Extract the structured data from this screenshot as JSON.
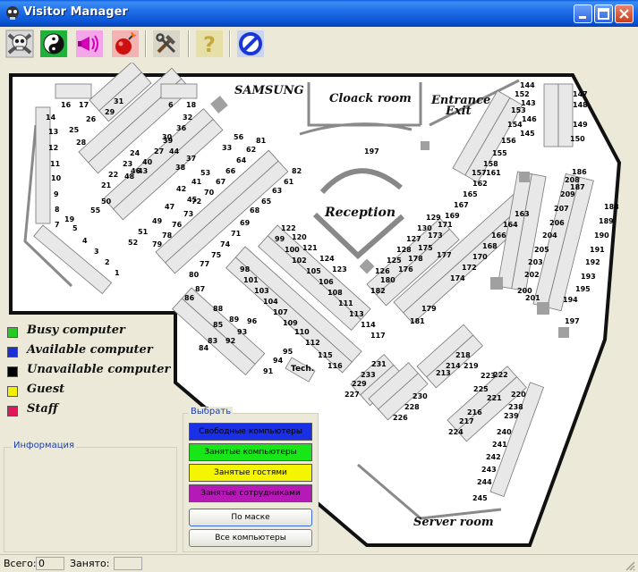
{
  "window": {
    "title": "Visitor Manager"
  },
  "toolbar": {
    "buttons": [
      {
        "name": "skull-icon"
      },
      {
        "name": "yin-yang-icon"
      },
      {
        "name": "megaphone-icon"
      },
      {
        "name": "bomb-icon"
      },
      {
        "name": "tools-icon"
      },
      {
        "name": "help-icon"
      },
      {
        "name": "stop-icon"
      }
    ]
  },
  "map": {
    "rooms": {
      "samsung": "SAMSUNG",
      "cloak": "Cloack room",
      "entrance1": "Entrance",
      "entrance2": "Exit",
      "reception": "Reception",
      "server": "Server room",
      "tech": "Tech."
    },
    "labels": [
      [
        "16",
        68,
        50
      ],
      [
        "17",
        88,
        50
      ],
      [
        "6",
        188,
        50
      ],
      [
        "18",
        208,
        50
      ],
      [
        "31",
        127,
        46
      ],
      [
        "29",
        117,
        58
      ],
      [
        "26",
        96,
        66
      ],
      [
        "28",
        85,
        92
      ],
      [
        "25",
        77,
        78
      ],
      [
        "32",
        204,
        64
      ],
      [
        "30",
        181,
        86
      ],
      [
        "36",
        197,
        76
      ],
      [
        "39",
        182,
        90
      ],
      [
        "27",
        172,
        102
      ],
      [
        "40",
        159,
        114
      ],
      [
        "24",
        145,
        104
      ],
      [
        "43",
        154,
        124
      ],
      [
        "46",
        146,
        124
      ],
      [
        "23",
        137,
        116
      ],
      [
        "48",
        139,
        130
      ],
      [
        "22",
        121,
        128
      ],
      [
        "21",
        113,
        140
      ],
      [
        "14",
        51,
        64
      ],
      [
        "13",
        54,
        80
      ],
      [
        "12",
        54,
        98
      ],
      [
        "11",
        56,
        116
      ],
      [
        "10",
        57,
        132
      ],
      [
        "9",
        60,
        150
      ],
      [
        "8",
        61,
        167
      ],
      [
        "7",
        61,
        184
      ],
      [
        "19",
        72,
        178
      ],
      [
        "5",
        81,
        188
      ],
      [
        "4",
        92,
        202
      ],
      [
        "3",
        105,
        214
      ],
      [
        "2",
        117,
        226
      ],
      [
        "1",
        128,
        238
      ],
      [
        "44",
        189,
        102
      ],
      [
        "38",
        196,
        120
      ],
      [
        "37",
        208,
        110
      ],
      [
        "42",
        197,
        144
      ],
      [
        "41",
        214,
        136
      ],
      [
        "45",
        209,
        156
      ],
      [
        "47",
        184,
        164
      ],
      [
        "49",
        170,
        180
      ],
      [
        "51",
        154,
        192
      ],
      [
        "52",
        143,
        204
      ],
      [
        "53",
        224,
        126
      ],
      [
        "50",
        113,
        158
      ],
      [
        "55",
        101,
        168
      ],
      [
        "56",
        261,
        86
      ],
      [
        "33",
        248,
        98
      ],
      [
        "81",
        286,
        90
      ],
      [
        "62",
        275,
        100
      ],
      [
        "64",
        264,
        112
      ],
      [
        "66",
        252,
        124
      ],
      [
        "67",
        241,
        136
      ],
      [
        "70",
        228,
        148
      ],
      [
        "72",
        214,
        158
      ],
      [
        "73",
        205,
        172
      ],
      [
        "76",
        192,
        184
      ],
      [
        "78",
        181,
        196
      ],
      [
        "79",
        170,
        206
      ],
      [
        "82",
        326,
        124
      ],
      [
        "61",
        317,
        136
      ],
      [
        "63",
        304,
        146
      ],
      [
        "65",
        292,
        158
      ],
      [
        "68",
        279,
        168
      ],
      [
        "69",
        268,
        182
      ],
      [
        "71",
        258,
        194
      ],
      [
        "74",
        246,
        206
      ],
      [
        "75",
        236,
        218
      ],
      [
        "77",
        223,
        228
      ],
      [
        "80",
        211,
        240
      ],
      [
        "122",
        314,
        188
      ],
      [
        "99",
        307,
        200
      ],
      [
        "120",
        326,
        198
      ],
      [
        "121",
        338,
        210
      ],
      [
        "124",
        357,
        222
      ],
      [
        "123",
        371,
        234
      ],
      [
        "100",
        318,
        212
      ],
      [
        "102",
        326,
        224
      ],
      [
        "105",
        342,
        236
      ],
      [
        "106",
        356,
        248
      ],
      [
        "108",
        366,
        260
      ],
      [
        "111",
        378,
        272
      ],
      [
        "113",
        390,
        284
      ],
      [
        "114",
        403,
        296
      ],
      [
        "117",
        414,
        308
      ],
      [
        "98",
        268,
        234
      ],
      [
        "101",
        272,
        246
      ],
      [
        "103",
        284,
        258
      ],
      [
        "104",
        294,
        270
      ],
      [
        "107",
        305,
        282
      ],
      [
        "109",
        316,
        294
      ],
      [
        "110",
        329,
        304
      ],
      [
        "112",
        341,
        316
      ],
      [
        "115",
        355,
        330
      ],
      [
        "116",
        366,
        342
      ],
      [
        "87",
        218,
        256
      ],
      [
        "86",
        206,
        266
      ],
      [
        "88",
        238,
        278
      ],
      [
        "89",
        256,
        290
      ],
      [
        "96",
        276,
        292
      ],
      [
        "85",
        238,
        296
      ],
      [
        "92",
        252,
        314
      ],
      [
        "93",
        265,
        304
      ],
      [
        "83",
        232,
        314
      ],
      [
        "84",
        222,
        322
      ],
      [
        "95",
        316,
        326
      ],
      [
        "94",
        305,
        336
      ],
      [
        "91",
        294,
        348
      ],
      [
        "197",
        407,
        102
      ],
      [
        "129",
        476,
        176
      ],
      [
        "171",
        489,
        184
      ],
      [
        "130",
        466,
        188
      ],
      [
        "173",
        478,
        196
      ],
      [
        "127",
        454,
        200
      ],
      [
        "175",
        467,
        210
      ],
      [
        "128",
        443,
        212
      ],
      [
        "178",
        456,
        222
      ],
      [
        "125",
        432,
        224
      ],
      [
        "176",
        445,
        234
      ],
      [
        "126",
        419,
        236
      ],
      [
        "180",
        425,
        246
      ],
      [
        "182",
        414,
        258
      ],
      [
        "177",
        488,
        218
      ],
      [
        "162",
        528,
        138
      ],
      [
        "165",
        517,
        150
      ],
      [
        "167",
        507,
        162
      ],
      [
        "169",
        497,
        174
      ],
      [
        "164",
        562,
        184
      ],
      [
        "166",
        549,
        196
      ],
      [
        "168",
        539,
        208
      ],
      [
        "163",
        575,
        172
      ],
      [
        "170",
        528,
        220
      ],
      [
        "172",
        516,
        232
      ],
      [
        "174",
        503,
        244
      ],
      [
        "179",
        471,
        278
      ],
      [
        "181",
        458,
        292
      ],
      [
        "144",
        581,
        28
      ],
      [
        "152",
        575,
        38
      ],
      [
        "143",
        582,
        48
      ],
      [
        "153",
        571,
        56
      ],
      [
        "146",
        583,
        66
      ],
      [
        "154",
        567,
        72
      ],
      [
        "145",
        581,
        82
      ],
      [
        "156",
        560,
        90
      ],
      [
        "155",
        550,
        104
      ],
      [
        "158",
        540,
        116
      ],
      [
        "157",
        527,
        126
      ],
      [
        "161",
        543,
        126
      ],
      [
        "147",
        640,
        38
      ],
      [
        "148",
        640,
        50
      ],
      [
        "149",
        640,
        72
      ],
      [
        "150",
        637,
        88
      ],
      [
        "186",
        639,
        125
      ],
      [
        "208",
        631,
        134
      ],
      [
        "187",
        637,
        142
      ],
      [
        "209",
        626,
        150
      ],
      [
        "188",
        675,
        164
      ],
      [
        "189",
        669,
        180
      ],
      [
        "190",
        664,
        196
      ],
      [
        "191",
        659,
        212
      ],
      [
        "192",
        654,
        226
      ],
      [
        "193",
        649,
        242
      ],
      [
        "195",
        643,
        256
      ],
      [
        "194",
        629,
        268
      ],
      [
        "207",
        619,
        166
      ],
      [
        "206",
        614,
        182
      ],
      [
        "204",
        606,
        196
      ],
      [
        "205",
        597,
        212
      ],
      [
        "203",
        590,
        226
      ],
      [
        "202",
        586,
        240
      ],
      [
        "200",
        578,
        258
      ],
      [
        "201",
        587,
        266
      ],
      [
        "197",
        631,
        292
      ],
      [
        "218",
        509,
        330
      ],
      [
        "214",
        498,
        342
      ],
      [
        "219",
        518,
        342
      ],
      [
        "213",
        487,
        350
      ],
      [
        "231",
        415,
        340
      ],
      [
        "233",
        403,
        352
      ],
      [
        "229",
        393,
        362
      ],
      [
        "227",
        385,
        374
      ],
      [
        "230",
        461,
        376
      ],
      [
        "228",
        452,
        388
      ],
      [
        "226",
        439,
        400
      ],
      [
        "223",
        537,
        353
      ],
      [
        "222",
        551,
        352
      ],
      [
        "225",
        529,
        368
      ],
      [
        "221",
        544,
        378
      ],
      [
        "220",
        571,
        374
      ],
      [
        "216",
        522,
        394
      ],
      [
        "217",
        513,
        404
      ],
      [
        "224",
        501,
        416
      ],
      [
        "238",
        568,
        388
      ],
      [
        "239",
        563,
        398
      ],
      [
        "240",
        555,
        416
      ],
      [
        "241",
        550,
        430
      ],
      [
        "242",
        543,
        444
      ],
      [
        "243",
        538,
        458
      ],
      [
        "244",
        533,
        472
      ],
      [
        "245",
        528,
        490
      ]
    ]
  },
  "legend": [
    {
      "label": "Busy computer",
      "color": "#22cc22"
    },
    {
      "label": "Available computer",
      "color": "#1a2fd8"
    },
    {
      "label": "Unavailable computer",
      "color": "#000000"
    },
    {
      "label": "Guest",
      "color": "#f0f000"
    },
    {
      "label": "Staff",
      "color": "#e0185a"
    }
  ],
  "info": {
    "caption": "Информация"
  },
  "select": {
    "caption": "Выбрать",
    "filters": [
      {
        "label": "Свободные компьютеры",
        "color": "#1a2fe8"
      },
      {
        "label": "Занятые компьютеры",
        "color": "#19e619"
      },
      {
        "label": "Занятые гостями",
        "color": "#f5f500"
      },
      {
        "label": "Занятые сотрудниками",
        "color": "#b61ab6"
      }
    ],
    "mask_label": "По маске",
    "all_label": "Все компьютеры"
  },
  "status": {
    "total_label": "Всего:",
    "total_value": "0",
    "busy_label": "Занято:",
    "busy_value": ""
  }
}
